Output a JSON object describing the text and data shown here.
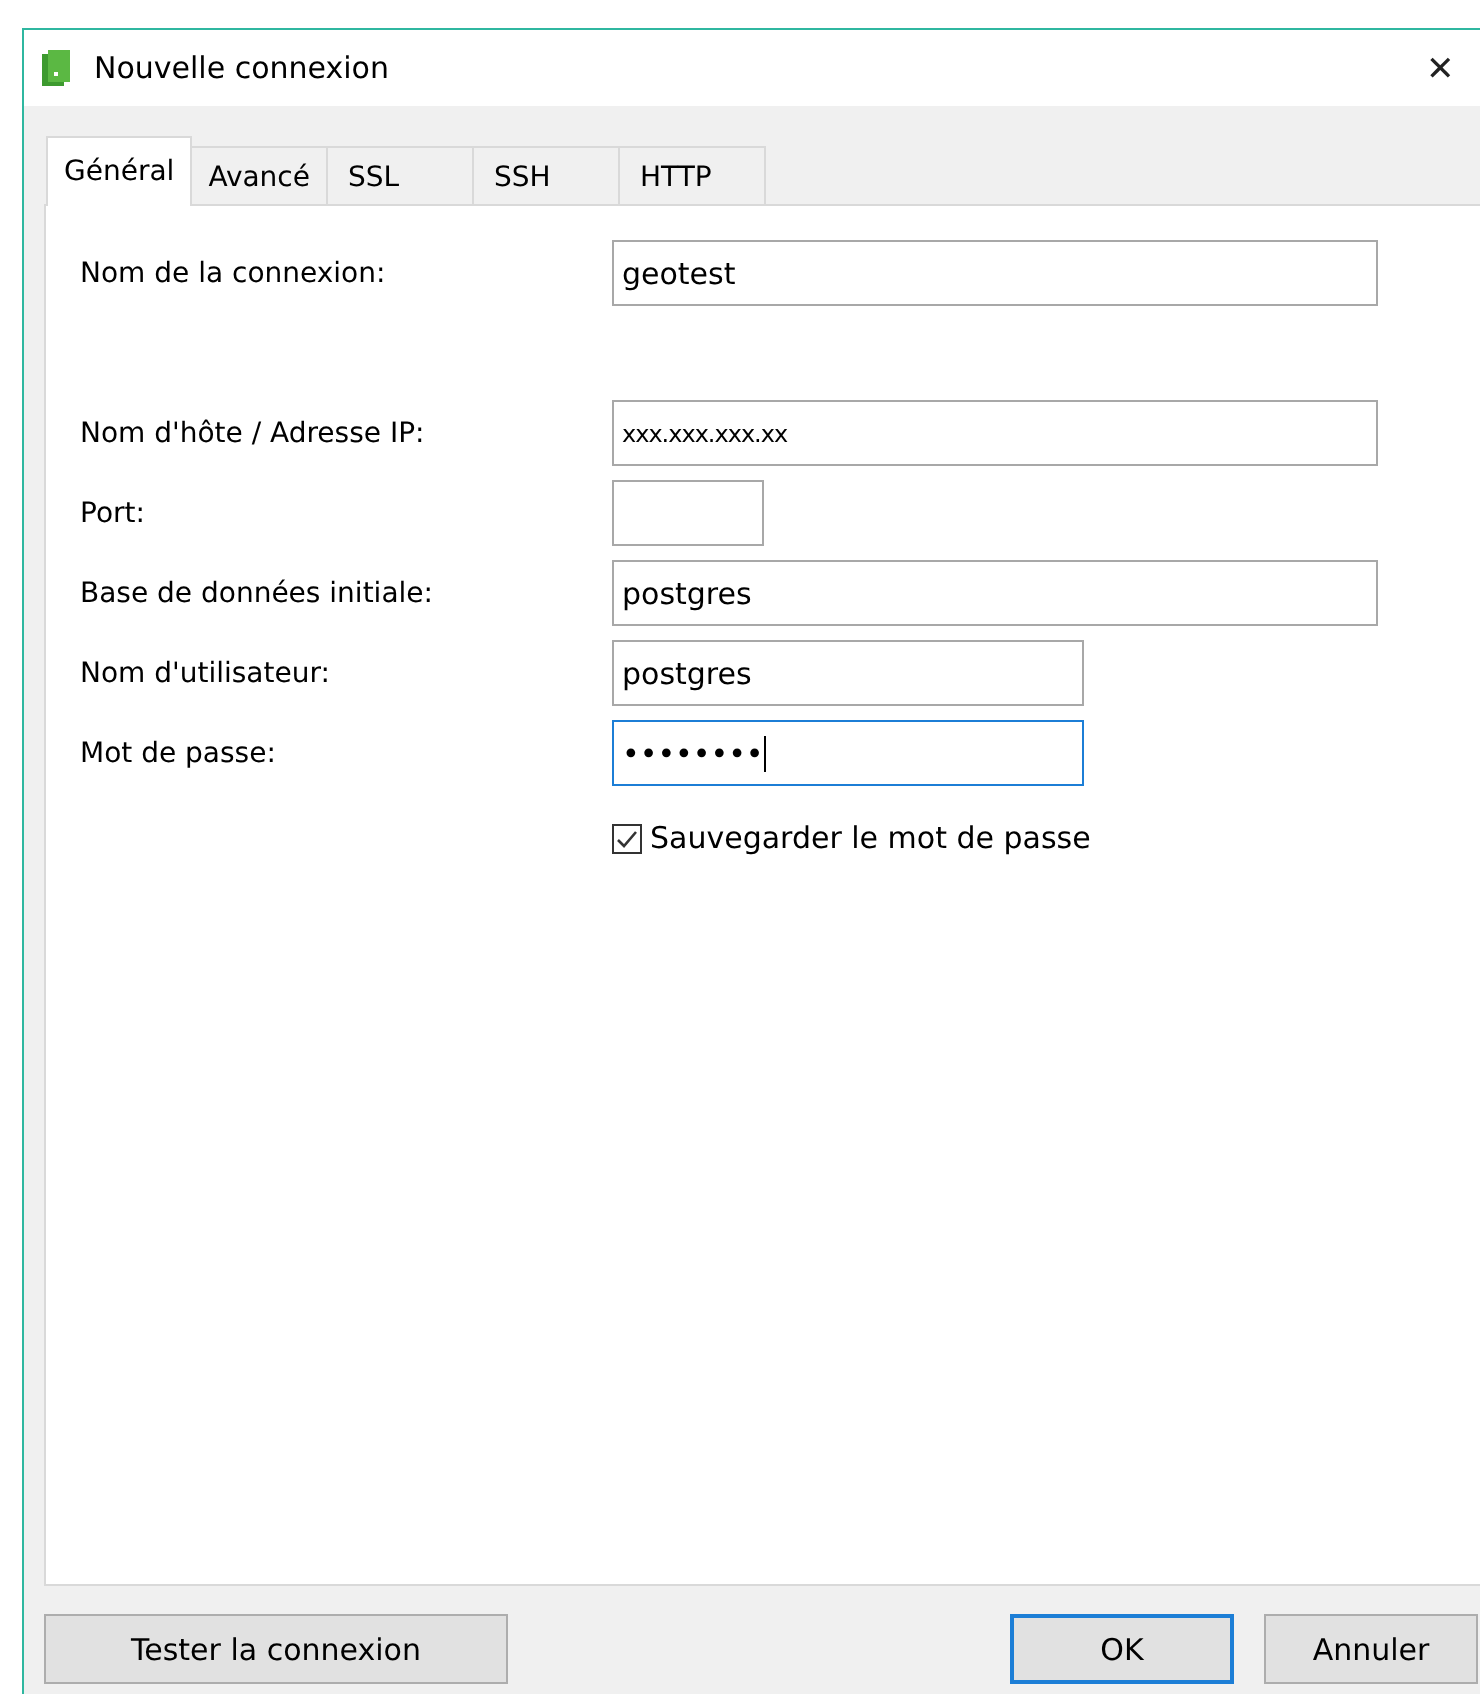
{
  "window": {
    "title": "Nouvelle connexion",
    "close": "✕"
  },
  "tabs": [
    {
      "label": "Général",
      "selected": true
    },
    {
      "label": "Avancé",
      "selected": false
    },
    {
      "label": "SSL",
      "selected": false
    },
    {
      "label": "SSH",
      "selected": false
    },
    {
      "label": "HTTP",
      "selected": false
    }
  ],
  "field_groups": [
    {
      "fields": [
        {
          "label": "Nom de la connexion:",
          "value": "geotest",
          "kind": "wide",
          "focused": false
        }
      ]
    },
    {
      "fields": [
        {
          "label": "Nom d'hôte / Adresse IP:",
          "value": "xxx.xxx.xxx.xx",
          "kind": "wide",
          "focused": false
        },
        {
          "label": "Port:",
          "kind": "tiny",
          "focused": false
        },
        {
          "label": "Base de données initiale:",
          "value": "postgres",
          "kind": "wide",
          "focused": false
        },
        {
          "label": "Nom d'utilisateur:",
          "value": "postgres",
          "kind": "medium",
          "focused": false
        },
        {
          "label": "Mot de passe:",
          "value": "••••••••",
          "kind": "medium",
          "focused": true
        }
      ]
    }
  ],
  "save_password": {
    "label": "Sauvegarder le mot de passe",
    "checked": true
  },
  "left_buttons": [
    {
      "label": "Tester la connexion",
      "default": false
    }
  ],
  "right_buttons": [
    {
      "label": "OK",
      "default": true
    },
    {
      "label": "Annuler",
      "default": false
    }
  ]
}
